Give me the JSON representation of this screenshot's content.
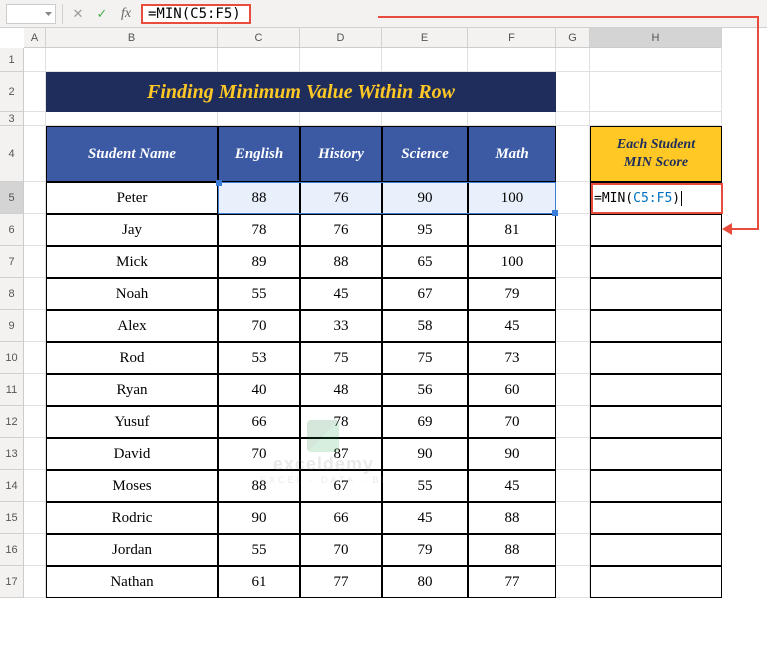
{
  "formula_bar": {
    "formula_text": "=MIN(C5:F5)",
    "formula_prefix": "=MIN(",
    "formula_range": "C5:F5",
    "formula_suffix": ")"
  },
  "columns": [
    "A",
    "B",
    "C",
    "D",
    "E",
    "F",
    "G",
    "H"
  ],
  "rows": [
    "1",
    "2",
    "3",
    "4",
    "5",
    "6",
    "7",
    "8",
    "9",
    "10",
    "11",
    "12",
    "13",
    "14",
    "15",
    "16",
    "17"
  ],
  "title": "Finding Minimum Value Within Row",
  "headers": {
    "student": "Student Name",
    "english": "English",
    "history": "History",
    "science": "Science",
    "math": "Math"
  },
  "side_header": {
    "line1": "Each Student",
    "line2": "MIN Score"
  },
  "cell_formula": {
    "prefix": "=MIN(",
    "range": "C5:F5",
    "suffix": ")"
  },
  "students": [
    {
      "name": "Peter",
      "english": "88",
      "history": "76",
      "science": "90",
      "math": "100"
    },
    {
      "name": "Jay",
      "english": "78",
      "history": "76",
      "science": "95",
      "math": "81"
    },
    {
      "name": "Mick",
      "english": "89",
      "history": "88",
      "science": "65",
      "math": "100"
    },
    {
      "name": "Noah",
      "english": "55",
      "history": "45",
      "science": "67",
      "math": "79"
    },
    {
      "name": "Alex",
      "english": "70",
      "history": "33",
      "science": "58",
      "math": "45"
    },
    {
      "name": "Rod",
      "english": "53",
      "history": "75",
      "science": "75",
      "math": "73"
    },
    {
      "name": "Ryan",
      "english": "40",
      "history": "48",
      "science": "56",
      "math": "60"
    },
    {
      "name": "Yusuf",
      "english": "66",
      "history": "78",
      "science": "69",
      "math": "70"
    },
    {
      "name": "David",
      "english": "70",
      "history": "87",
      "science": "90",
      "math": "90"
    },
    {
      "name": "Moses",
      "english": "88",
      "history": "67",
      "science": "55",
      "math": "45"
    },
    {
      "name": "Rodric",
      "english": "90",
      "history": "66",
      "science": "45",
      "math": "88"
    },
    {
      "name": "Jordan",
      "english": "55",
      "history": "70",
      "science": "79",
      "math": "88"
    },
    {
      "name": "Nathan",
      "english": "61",
      "history": "77",
      "science": "80",
      "math": "77"
    }
  ],
  "watermark": {
    "name": "exceldemy",
    "tag": "EXCEL · DATA · BI"
  }
}
